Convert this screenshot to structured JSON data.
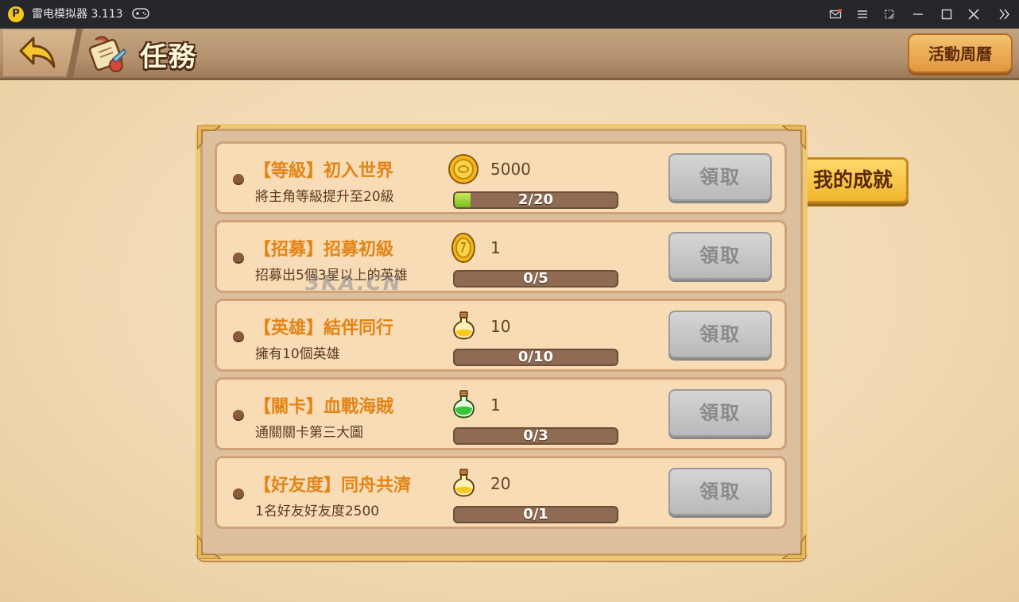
{
  "window": {
    "app_title": "雷电模拟器 3.113",
    "logo_glyph": "P",
    "controls": [
      "mail-icon",
      "menu-icon",
      "screen-icon",
      "minimize-icon",
      "maximize-icon",
      "close-icon",
      "expand-icon"
    ]
  },
  "header": {
    "title": "任務",
    "activity_button": "活動周曆"
  },
  "achievement_button": "我的成就",
  "watermark": "3KA.CN",
  "tasks": [
    {
      "title": "【等級】初入世界",
      "desc": "將主角等級提升至20級",
      "reward_icon": "gold-coin-icon",
      "reward_amount": "5000",
      "progress_text": "2/20",
      "progress_fraction": 0.1,
      "button": "領取"
    },
    {
      "title": "【招募】招募初級",
      "desc": "招募出5個3星以上的英雄",
      "reward_icon": "recruit-coin-icon",
      "reward_amount": "1",
      "progress_text": "0/5",
      "progress_fraction": 0,
      "button": "領取"
    },
    {
      "title": "【英雄】結伴同行",
      "desc": "擁有10個英雄",
      "reward_icon": "yellow-potion-icon",
      "reward_amount": "10",
      "progress_text": "0/10",
      "progress_fraction": 0,
      "button": "領取"
    },
    {
      "title": "【關卡】血戰海賊",
      "desc": "通關關卡第三大圖",
      "reward_icon": "green-potion-icon",
      "reward_amount": "1",
      "progress_text": "0/3",
      "progress_fraction": 0,
      "button": "領取"
    },
    {
      "title": "【好友度】同舟共濟",
      "desc": "1名好友好友度2500",
      "reward_icon": "yellow-potion-icon",
      "reward_amount": "20",
      "progress_text": "0/1",
      "progress_fraction": 0,
      "button": "領取"
    }
  ],
  "colors": {
    "title_bar": "#25272c",
    "task_title": "#e38416",
    "progress_fill": "#7bbd20",
    "claim_disabled": "#b9b9b9",
    "panel_border": "#f0c872"
  }
}
